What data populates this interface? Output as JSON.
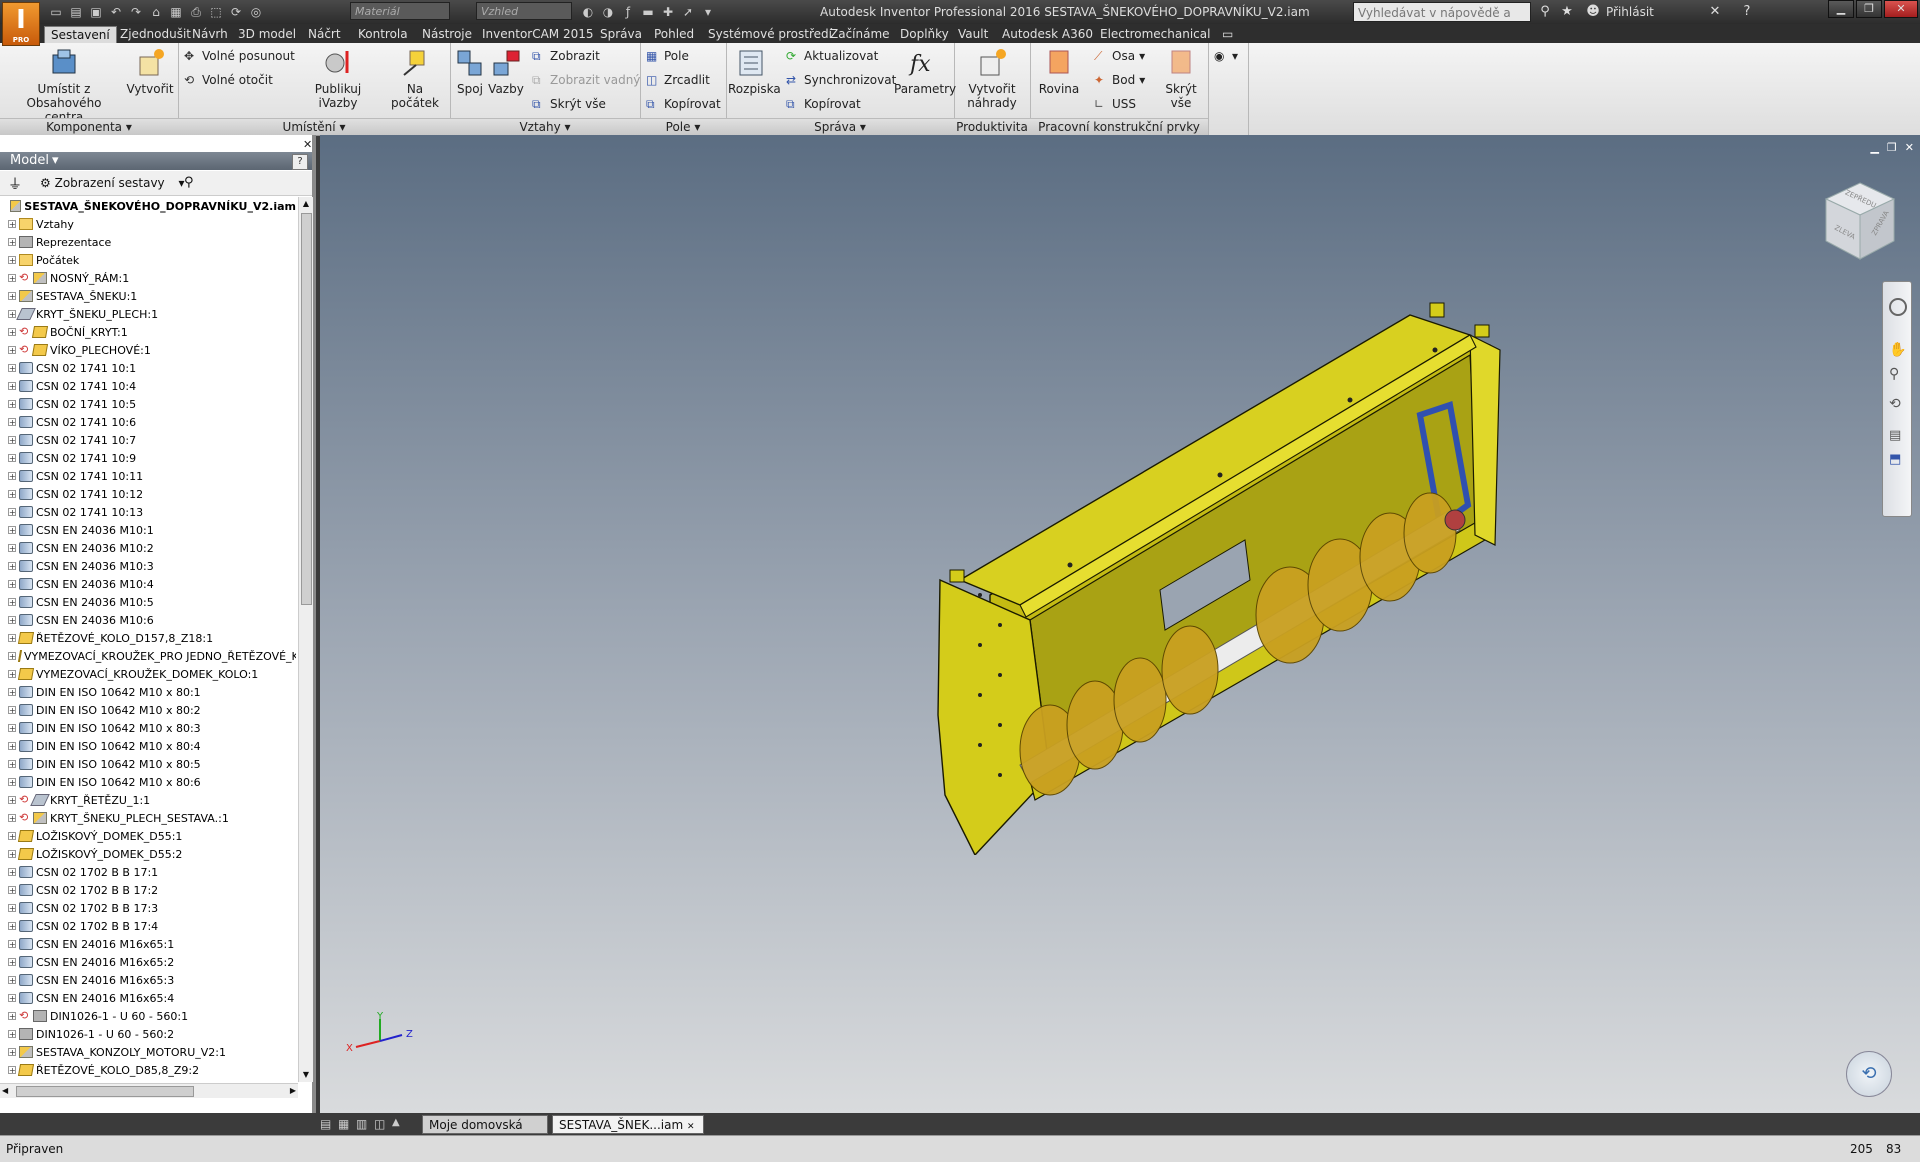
{
  "app": {
    "logo_letter": "I",
    "logo_sub": "PRO",
    "window_title": "Autodesk Inventor Professional 2016   SESTAVA_ŠNEKOVÉHO_DOPRAVNÍKU_V2.iam",
    "material_placeholder": "Materiál",
    "appearance_placeholder": "Vzhled",
    "help_search_placeholder": "Vyhledávat v nápovědě a příkaze",
    "sign_in": "Přihlásit"
  },
  "tabs": [
    "Sestavení",
    "Zjednodušit",
    "Návrh",
    "3D model",
    "Náčrt",
    "Kontrola",
    "Nástroje",
    "InventorCAM 2015",
    "Správa",
    "Pohled",
    "Systémové prostředí",
    "Začínáme",
    "Doplňky",
    "Vault",
    "Autodesk A360",
    "Electromechanical"
  ],
  "ribbon": {
    "komponenta": {
      "title": "Komponenta",
      "place_line1": "Umístit z",
      "place_line2": "Obsahového centra",
      "create": "Vytvořit"
    },
    "umisteni": {
      "title": "Umístění",
      "free_move": "Volné posunout",
      "free_rotate": "Volné otočit",
      "publish": "Publikuj iVazby",
      "origin": "Na počátek"
    },
    "vztahy": {
      "title": "Vztahy",
      "joint": "Spoj",
      "constrain": "Vazby",
      "show": "Zobrazit",
      "show_sick": "Zobrazit vadný",
      "hide_all": "Skrýt vše"
    },
    "pole": {
      "title": "Pole",
      "pattern": "Pole",
      "mirror": "Zrcadlit",
      "copy": "Kopírovat"
    },
    "sprava": {
      "title": "Správa",
      "bom": "Rozpiska",
      "update": "Aktualizovat",
      "sync": "Synchronizovat",
      "copy": "Kopírovat",
      "params": "Parametry"
    },
    "produktivita": {
      "title": "Produktivita",
      "create_line1": "Vytvořit",
      "create_line2": "náhrady"
    },
    "prvky": {
      "title": "Pracovní konstrukční prvky",
      "plane": "Rovina",
      "axis": "Osa",
      "point": "Bod",
      "ucs": "USS",
      "hide_all": "Skrýt vše"
    }
  },
  "browser": {
    "title": "Model",
    "view_label": "Zobrazení sestavy",
    "root": "SESTAVA_ŠNEKOVÉHO_DOPRAVNÍKU_V2.iam",
    "items": [
      {
        "label": "Vztahy",
        "icon": "folder",
        "ref": false
      },
      {
        "label": "Reprezentace",
        "icon": "gray",
        "ref": false
      },
      {
        "label": "Počátek",
        "icon": "folder",
        "ref": false
      },
      {
        "label": "NOSNÝ_RÁM:1",
        "icon": "asm",
        "ref": true
      },
      {
        "label": "SESTAVA_ŠNEKU:1",
        "icon": "asm",
        "ref": false
      },
      {
        "label": "KRYT_ŠNEKU_PLECH:1",
        "icon": "sheet",
        "ref": false
      },
      {
        "label": "BOČNÍ_KRYT:1",
        "icon": "part",
        "ref": true
      },
      {
        "label": "VÍKO_PLECHOVÉ:1",
        "icon": "part",
        "ref": true
      },
      {
        "label": "CSN 02 1741 10:1",
        "icon": "bolt",
        "ref": false
      },
      {
        "label": "CSN 02 1741 10:4",
        "icon": "bolt",
        "ref": false
      },
      {
        "label": "CSN 02 1741 10:5",
        "icon": "bolt",
        "ref": false
      },
      {
        "label": "CSN 02 1741 10:6",
        "icon": "bolt",
        "ref": false
      },
      {
        "label": "CSN 02 1741 10:7",
        "icon": "bolt",
        "ref": false
      },
      {
        "label": "CSN 02 1741 10:9",
        "icon": "bolt",
        "ref": false
      },
      {
        "label": "CSN 02 1741 10:11",
        "icon": "bolt",
        "ref": false
      },
      {
        "label": "CSN 02 1741 10:12",
        "icon": "bolt",
        "ref": false
      },
      {
        "label": "CSN 02 1741 10:13",
        "icon": "bolt",
        "ref": false
      },
      {
        "label": "CSN EN 24036 M10:1",
        "icon": "bolt",
        "ref": false
      },
      {
        "label": "CSN EN 24036 M10:2",
        "icon": "bolt",
        "ref": false
      },
      {
        "label": "CSN EN 24036 M10:3",
        "icon": "bolt",
        "ref": false
      },
      {
        "label": "CSN EN 24036 M10:4",
        "icon": "bolt",
        "ref": false
      },
      {
        "label": "CSN EN 24036 M10:5",
        "icon": "bolt",
        "ref": false
      },
      {
        "label": "CSN EN 24036 M10:6",
        "icon": "bolt",
        "ref": false
      },
      {
        "label": "ŘETĚZOVÉ_KOLO_D157,8_Z18:1",
        "icon": "part",
        "ref": false
      },
      {
        "label": "VYMEZOVACÍ_KROUŽEK_PRO JEDNO_ŘETĚZOVÉ_KO",
        "icon": "part",
        "ref": false
      },
      {
        "label": "VYMEZOVACÍ_KROUŽEK_DOMEK_KOLO:1",
        "icon": "part",
        "ref": false
      },
      {
        "label": "DIN EN ISO 10642 M10  x  80:1",
        "icon": "bolt",
        "ref": false
      },
      {
        "label": "DIN EN ISO 10642 M10  x  80:2",
        "icon": "bolt",
        "ref": false
      },
      {
        "label": "DIN EN ISO 10642 M10  x  80:3",
        "icon": "bolt",
        "ref": false
      },
      {
        "label": "DIN EN ISO 10642 M10  x  80:4",
        "icon": "bolt",
        "ref": false
      },
      {
        "label": "DIN EN ISO 10642 M10  x  80:5",
        "icon": "bolt",
        "ref": false
      },
      {
        "label": "DIN EN ISO 10642 M10  x  80:6",
        "icon": "bolt",
        "ref": false
      },
      {
        "label": "KRYT_ŘETĚZU_1:1",
        "icon": "sheet",
        "ref": true
      },
      {
        "label": "KRYT_ŠNEKU_PLECH_SESTAVA.:1",
        "icon": "asm",
        "ref": true
      },
      {
        "label": "LOŽISKOVÝ_DOMEK_D55:1",
        "icon": "part",
        "ref": false
      },
      {
        "label": "LOŽISKOVÝ_DOMEK_D55:2",
        "icon": "part",
        "ref": false
      },
      {
        "label": "CSN 02 1702 B B 17:1",
        "icon": "bolt",
        "ref": false
      },
      {
        "label": "CSN 02 1702 B B 17:2",
        "icon": "bolt",
        "ref": false
      },
      {
        "label": "CSN 02 1702 B B 17:3",
        "icon": "bolt",
        "ref": false
      },
      {
        "label": "CSN 02 1702 B B 17:4",
        "icon": "bolt",
        "ref": false
      },
      {
        "label": "CSN EN 24016 M16x65:1",
        "icon": "bolt",
        "ref": false
      },
      {
        "label": "CSN EN 24016 M16x65:2",
        "icon": "bolt",
        "ref": false
      },
      {
        "label": "CSN EN 24016 M16x65:3",
        "icon": "bolt",
        "ref": false
      },
      {
        "label": "CSN EN 24016 M16x65:4",
        "icon": "bolt",
        "ref": false
      },
      {
        "label": "DIN1026-1 - U 60 - 560:1",
        "icon": "gray",
        "ref": true
      },
      {
        "label": "DIN1026-1 - U 60 - 560:2",
        "icon": "gray",
        "ref": false
      },
      {
        "label": "SESTAVA_KONZOLY_MOTORU_V2:1",
        "icon": "asm",
        "ref": false
      },
      {
        "label": "ŘETĚZOVÉ_KOLO_D85,8_Z9:2",
        "icon": "part",
        "ref": false
      }
    ]
  },
  "viewcube": {
    "front": "ZEPŘEDU",
    "left": "ZLEVA",
    "right": "ZPRAVA"
  },
  "axes": {
    "x": "X",
    "y": "Y",
    "z": "Z"
  },
  "doc_tabs": [
    "Moje domovská str...",
    "SESTAVA_ŠNEK...iam"
  ],
  "status": {
    "text": "Připraven",
    "count_a": "205",
    "count_b": "83"
  },
  "colors": {
    "model_yellow": "#d4cc1a",
    "auger": "#c9a020",
    "shaft": "#e8e8e8",
    "chain": "#3050b0"
  }
}
